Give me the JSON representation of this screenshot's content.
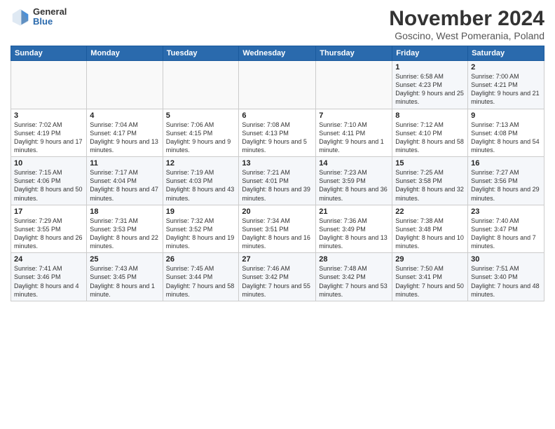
{
  "header": {
    "logo": {
      "line1": "General",
      "line2": "Blue"
    },
    "title": "November 2024",
    "subtitle": "Goscino, West Pomerania, Poland"
  },
  "weekdays": [
    "Sunday",
    "Monday",
    "Tuesday",
    "Wednesday",
    "Thursday",
    "Friday",
    "Saturday"
  ],
  "weeks": [
    [
      {
        "day": "",
        "info": ""
      },
      {
        "day": "",
        "info": ""
      },
      {
        "day": "",
        "info": ""
      },
      {
        "day": "",
        "info": ""
      },
      {
        "day": "",
        "info": ""
      },
      {
        "day": "1",
        "info": "Sunrise: 6:58 AM\nSunset: 4:23 PM\nDaylight: 9 hours\nand 25 minutes."
      },
      {
        "day": "2",
        "info": "Sunrise: 7:00 AM\nSunset: 4:21 PM\nDaylight: 9 hours\nand 21 minutes."
      }
    ],
    [
      {
        "day": "3",
        "info": "Sunrise: 7:02 AM\nSunset: 4:19 PM\nDaylight: 9 hours\nand 17 minutes."
      },
      {
        "day": "4",
        "info": "Sunrise: 7:04 AM\nSunset: 4:17 PM\nDaylight: 9 hours\nand 13 minutes."
      },
      {
        "day": "5",
        "info": "Sunrise: 7:06 AM\nSunset: 4:15 PM\nDaylight: 9 hours\nand 9 minutes."
      },
      {
        "day": "6",
        "info": "Sunrise: 7:08 AM\nSunset: 4:13 PM\nDaylight: 9 hours\nand 5 minutes."
      },
      {
        "day": "7",
        "info": "Sunrise: 7:10 AM\nSunset: 4:11 PM\nDaylight: 9 hours\nand 1 minute."
      },
      {
        "day": "8",
        "info": "Sunrise: 7:12 AM\nSunset: 4:10 PM\nDaylight: 8 hours\nand 58 minutes."
      },
      {
        "day": "9",
        "info": "Sunrise: 7:13 AM\nSunset: 4:08 PM\nDaylight: 8 hours\nand 54 minutes."
      }
    ],
    [
      {
        "day": "10",
        "info": "Sunrise: 7:15 AM\nSunset: 4:06 PM\nDaylight: 8 hours\nand 50 minutes."
      },
      {
        "day": "11",
        "info": "Sunrise: 7:17 AM\nSunset: 4:04 PM\nDaylight: 8 hours\nand 47 minutes."
      },
      {
        "day": "12",
        "info": "Sunrise: 7:19 AM\nSunset: 4:03 PM\nDaylight: 8 hours\nand 43 minutes."
      },
      {
        "day": "13",
        "info": "Sunrise: 7:21 AM\nSunset: 4:01 PM\nDaylight: 8 hours\nand 39 minutes."
      },
      {
        "day": "14",
        "info": "Sunrise: 7:23 AM\nSunset: 3:59 PM\nDaylight: 8 hours\nand 36 minutes."
      },
      {
        "day": "15",
        "info": "Sunrise: 7:25 AM\nSunset: 3:58 PM\nDaylight: 8 hours\nand 32 minutes."
      },
      {
        "day": "16",
        "info": "Sunrise: 7:27 AM\nSunset: 3:56 PM\nDaylight: 8 hours\nand 29 minutes."
      }
    ],
    [
      {
        "day": "17",
        "info": "Sunrise: 7:29 AM\nSunset: 3:55 PM\nDaylight: 8 hours\nand 26 minutes."
      },
      {
        "day": "18",
        "info": "Sunrise: 7:31 AM\nSunset: 3:53 PM\nDaylight: 8 hours\nand 22 minutes."
      },
      {
        "day": "19",
        "info": "Sunrise: 7:32 AM\nSunset: 3:52 PM\nDaylight: 8 hours\nand 19 minutes."
      },
      {
        "day": "20",
        "info": "Sunrise: 7:34 AM\nSunset: 3:51 PM\nDaylight: 8 hours\nand 16 minutes."
      },
      {
        "day": "21",
        "info": "Sunrise: 7:36 AM\nSunset: 3:49 PM\nDaylight: 8 hours\nand 13 minutes."
      },
      {
        "day": "22",
        "info": "Sunrise: 7:38 AM\nSunset: 3:48 PM\nDaylight: 8 hours\nand 10 minutes."
      },
      {
        "day": "23",
        "info": "Sunrise: 7:40 AM\nSunset: 3:47 PM\nDaylight: 8 hours\nand 7 minutes."
      }
    ],
    [
      {
        "day": "24",
        "info": "Sunrise: 7:41 AM\nSunset: 3:46 PM\nDaylight: 8 hours\nand 4 minutes."
      },
      {
        "day": "25",
        "info": "Sunrise: 7:43 AM\nSunset: 3:45 PM\nDaylight: 8 hours\nand 1 minute."
      },
      {
        "day": "26",
        "info": "Sunrise: 7:45 AM\nSunset: 3:44 PM\nDaylight: 7 hours\nand 58 minutes."
      },
      {
        "day": "27",
        "info": "Sunrise: 7:46 AM\nSunset: 3:42 PM\nDaylight: 7 hours\nand 55 minutes."
      },
      {
        "day": "28",
        "info": "Sunrise: 7:48 AM\nSunset: 3:42 PM\nDaylight: 7 hours\nand 53 minutes."
      },
      {
        "day": "29",
        "info": "Sunrise: 7:50 AM\nSunset: 3:41 PM\nDaylight: 7 hours\nand 50 minutes."
      },
      {
        "day": "30",
        "info": "Sunrise: 7:51 AM\nSunset: 3:40 PM\nDaylight: 7 hours\nand 48 minutes."
      }
    ]
  ]
}
